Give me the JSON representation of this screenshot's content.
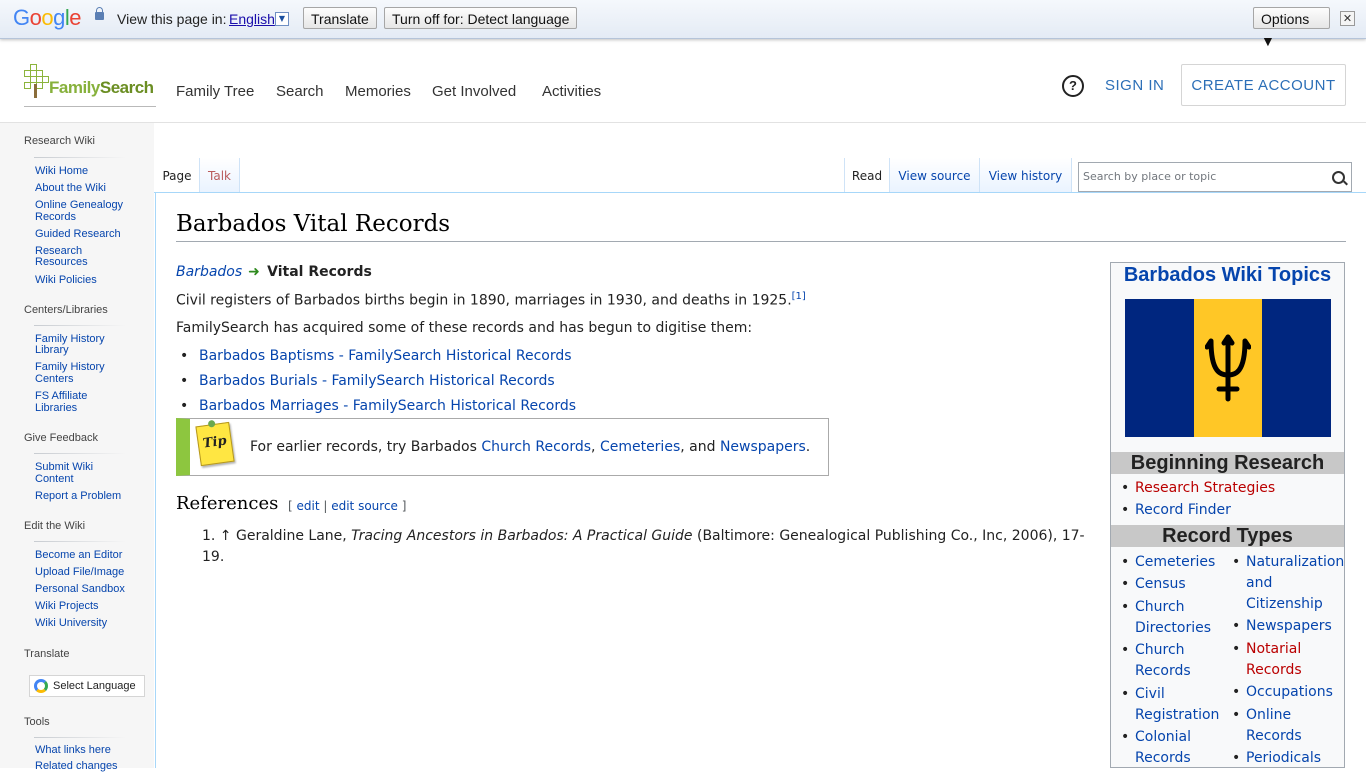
{
  "google_bar": {
    "logo": [
      "G",
      "o",
      "o",
      "g",
      "l",
      "e"
    ],
    "view_label": "View this page in:",
    "language": "English",
    "translate_btn": "Translate",
    "turn_off_btn": "Turn off for: Detect language",
    "options_btn": "Options ▼",
    "close": "✕"
  },
  "header": {
    "logo_family": "Family",
    "logo_search": "Search",
    "nav": [
      "Family Tree",
      "Search",
      "Memories",
      "Get Involved",
      "Activities"
    ],
    "help": "?",
    "sign_in": "SIGN IN",
    "create_account": "CREATE ACCOUNT"
  },
  "sidebar": {
    "heading_wiki": "Research Wiki",
    "wiki_links": [
      "Wiki Home",
      "About the Wiki",
      "Online Genealogy",
      "Records",
      "Guided Research",
      "Research",
      "Resources",
      "Wiki Policies"
    ],
    "heading_centers": "Centers/Libraries",
    "center_links": [
      "Family History",
      "Library",
      "Family History",
      "Centers",
      "FS Affiliate",
      "Libraries"
    ],
    "heading_feedback": "Give Feedback",
    "feedback_links": [
      "Submit Wiki",
      "Content",
      "Report a Problem"
    ],
    "heading_edit": "Edit the Wiki",
    "edit_links": [
      "Become an Editor",
      "Upload File/Image",
      "Personal Sandbox",
      "Wiki Projects",
      "Wiki University"
    ],
    "heading_translate": "Translate",
    "select_language": "Select Language",
    "heading_tools": "Tools",
    "tool_links": [
      "What links here",
      "Related changes"
    ]
  },
  "tabs": {
    "page": "Page",
    "talk": "Talk",
    "read": "Read",
    "view_source": "View source",
    "view_history": "View history",
    "search_placeholder": "Search by place or topic"
  },
  "article": {
    "title": "Barbados Vital Records",
    "crumb_link": "Barbados",
    "crumb_current": "Vital Records",
    "para1": "Civil registers of Barbados births begin in 1890, marriages in 1930, and deaths in 1925.",
    "para1_ref": "[1]",
    "para2": "FamilySearch has acquired some of these records and has begun to digitise them:",
    "links": [
      "Barbados Baptisms - FamilySearch Historical Records",
      "Barbados Burials - FamilySearch Historical Records",
      "Barbados Marriages - FamilySearch Historical Records"
    ],
    "tip_note": "Tip",
    "tip_prefix": "For earlier records, try Barbados ",
    "tip_link1": "Church Records",
    "tip_sep1": ", ",
    "tip_link2": "Cemeteries",
    "tip_sep2": ", and ",
    "tip_link3": "Newspapers",
    "tip_end": ".",
    "references_heading": "References",
    "ref_open": "[ ",
    "ref_edit": "edit",
    "ref_bar": " | ",
    "ref_edit_source": "edit source",
    "ref_close": " ]",
    "ref_num": "1. ↑ ",
    "ref_author": "Geraldine Lane, ",
    "ref_book": "Tracing Ancestors in Barbados: A Practical Guide",
    "ref_pub": " (Baltimore: Genealogical Publishing Co., Inc, 2006), 17-19."
  },
  "infobox": {
    "title": "Barbados Wiki Topics",
    "flag_colors": [
      "#00267f",
      "#ffc726",
      "#00267f"
    ],
    "section_beginning": "Beginning Research",
    "beginning_links": [
      "Research Strategies",
      "Record Finder"
    ],
    "section_record_types": "Record Types",
    "left_col": [
      "Cemeteries",
      "Census",
      "Church",
      "Directories",
      "Church",
      "Records",
      "Civil",
      "Registration",
      "Colonial",
      "Records"
    ],
    "right_col": [
      "Naturalization",
      "and",
      "Citizenship",
      "Newspapers",
      "Notarial",
      "Records",
      "Occupations",
      "Online",
      "Records",
      "Periodicals"
    ]
  }
}
